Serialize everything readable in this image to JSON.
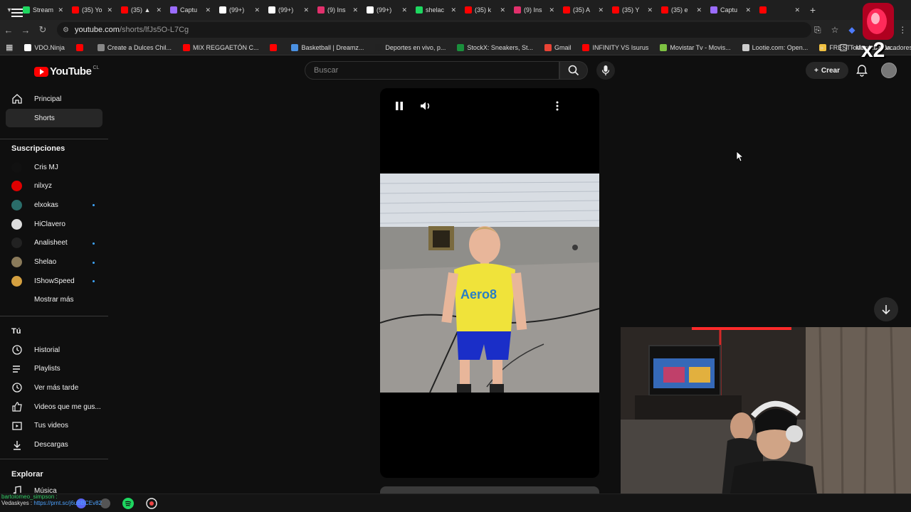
{
  "browser": {
    "tabs": [
      {
        "title": "Stream",
        "color": "#1ed760"
      },
      {
        "title": "(35) Yo",
        "color": "#ff0000"
      },
      {
        "title": "(35) ▲",
        "color": "#ff0000"
      },
      {
        "title": "Captu",
        "color": "#9b6cff"
      },
      {
        "title": "(99+) ",
        "color": "#ffffff"
      },
      {
        "title": "(99+) ",
        "color": "#ffffff"
      },
      {
        "title": "(9) Ins",
        "color": "#e1306c"
      },
      {
        "title": "(99+) ",
        "color": "#ffffff"
      },
      {
        "title": "shelac",
        "color": "#1ed760"
      },
      {
        "title": "(35) k",
        "color": "#ff0000"
      },
      {
        "title": "(9) Ins",
        "color": "#e1306c"
      },
      {
        "title": "(35) A",
        "color": "#ff0000"
      },
      {
        "title": "(35) Y",
        "color": "#ff0000"
      },
      {
        "title": "(35) e",
        "color": "#ff0000"
      },
      {
        "title": "Captu",
        "color": "#9b6cff"
      },
      {
        "title": "",
        "color": "#ff0000"
      }
    ],
    "url_host": "youtube.com",
    "url_path": "/shorts/lfJs5O-L7Cg",
    "bookmarks": [
      {
        "label": "VDO.Ninja",
        "color": "#ffffff"
      },
      {
        "label": "",
        "color": "#ff0000"
      },
      {
        "label": "Create a Dulces Chil...",
        "color": "#888888"
      },
      {
        "label": "MIX REGGAETÓN C...",
        "color": "#ff0000"
      },
      {
        "label": "",
        "color": "#ff0000"
      },
      {
        "label": "Basketball | Dreamz...",
        "color": "#4a90e2"
      },
      {
        "label": "Deportes en vivo, p...",
        "color": "#222222"
      },
      {
        "label": "StockX: Sneakers, St...",
        "color": "#1a8f3c"
      },
      {
        "label": "Gmail",
        "color": "#ea4335"
      },
      {
        "label": "INFINITY VS Isurus",
        "color": "#ff0000"
      },
      {
        "label": "Movistar Tv - Movis...",
        "color": "#7ec242"
      },
      {
        "label": "Lootie.com: Open...",
        "color": "#cccccc"
      },
      {
        "label": "FREST - Mercado Sa...",
        "color": "#f0c040"
      }
    ],
    "bookmarks_more": "»",
    "bookmarks_folder": "Todos los marcadores"
  },
  "header": {
    "logo_text": "YouTube",
    "country": "CL",
    "search_placeholder": "Buscar",
    "create_label": "Crear"
  },
  "sidebar": {
    "main": [
      {
        "label": "Principal",
        "icon": "home-icon"
      },
      {
        "label": "Shorts",
        "icon": "shorts-icon",
        "active": true
      }
    ],
    "subs_title": "Suscripciones",
    "subs": [
      {
        "label": "Cris MJ",
        "color": "#111111",
        "dot": false
      },
      {
        "label": "nilxyz",
        "color": "#e00000",
        "dot": false
      },
      {
        "label": "elxokas",
        "color": "#2a6d6a",
        "dot": true
      },
      {
        "label": "HiClavero",
        "color": "#dddddd",
        "dot": false
      },
      {
        "label": "Analisheet",
        "color": "#222222",
        "dot": true
      },
      {
        "label": "Shelao",
        "color": "#8a7a5a",
        "dot": true
      },
      {
        "label": "IShowSpeed",
        "color": "#d4a040",
        "dot": true
      }
    ],
    "show_more": "Mostrar más",
    "you_title": "Tú",
    "you": [
      {
        "label": "Historial",
        "icon": "history-icon"
      },
      {
        "label": "Playlists",
        "icon": "playlists-icon"
      },
      {
        "label": "Ver más tarde",
        "icon": "watch-later-icon"
      },
      {
        "label": "Videos que me gus...",
        "icon": "liked-icon"
      },
      {
        "label": "Tus videos",
        "icon": "your-videos-icon"
      },
      {
        "label": "Descargas",
        "icon": "downloads-icon"
      }
    ],
    "explore_title": "Explorar",
    "explore": [
      {
        "label": "Música",
        "icon": "music-icon"
      }
    ]
  },
  "player": {
    "shirt_text": "Aero8"
  },
  "overlay": {
    "badge_text": "x2",
    "chat_user1": "bartolomeo_simpson :",
    "chat_user2": "Vedaskyes :",
    "chat_link": "https://prnt.sc/j6uBBCEv82"
  },
  "colors": {
    "accent": "#3ea6ff",
    "brand": "#ff0000"
  }
}
